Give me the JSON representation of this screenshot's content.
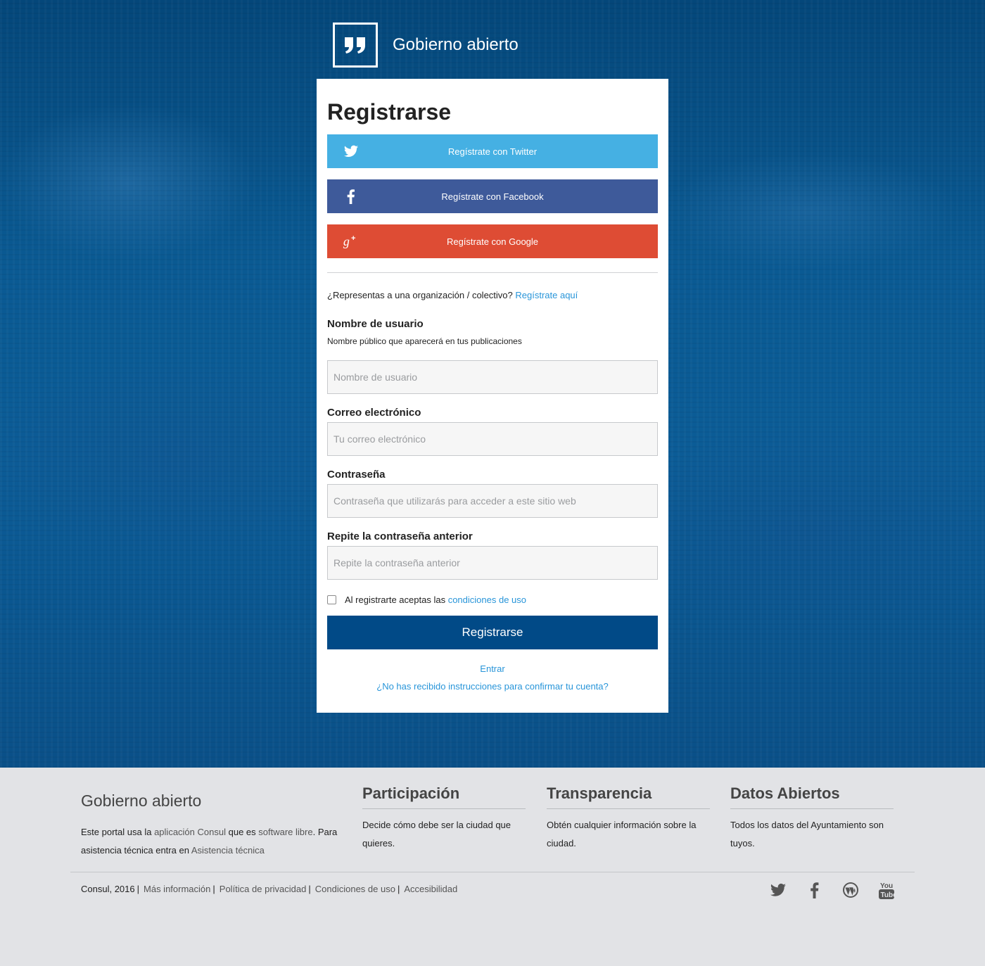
{
  "brand": {
    "name": "Gobierno abierto"
  },
  "form": {
    "title": "Registrarse",
    "twitter_label": "Regístrate con Twitter",
    "facebook_label": "Regístrate con Facebook",
    "google_label": "Regístrate con Google",
    "org_question": "¿Representas a una organización / colectivo?",
    "org_link": "Regístrate aquí",
    "username_label": "Nombre de usuario",
    "username_help": "Nombre público que aparecerá en tus publicaciones",
    "username_placeholder": "Nombre de usuario",
    "email_label": "Correo electrónico",
    "email_placeholder": "Tu correo electrónico",
    "password_label": "Contraseña",
    "password_placeholder": "Contraseña que utilizarás para acceder a este sitio web",
    "password_confirm_label": "Repite la contraseña anterior",
    "password_confirm_placeholder": "Repite la contraseña anterior",
    "terms_text": "Al registrarte aceptas las",
    "terms_link": "condiciones de uso",
    "terms_checked": false,
    "submit_label": "Registrarse",
    "login_link": "Entrar",
    "confirm_link": "¿No has recibido instrucciones para confirmar tu cuenta?"
  },
  "footer": {
    "brand": "Gobierno abierto",
    "desc_1": "Este portal usa la",
    "desc_link_1": "aplicación Consul",
    "desc_2": "que es",
    "desc_link_2": "software libre",
    "desc_3": ". Para asistencia técnica entra en",
    "desc_link_3": "Asistencia técnica",
    "columns": [
      {
        "title": "Participación",
        "text": "Decide cómo debe ser la ciudad que quieres."
      },
      {
        "title": "Transparencia",
        "text": "Obtén cualquier información sobre la ciudad."
      },
      {
        "title": "Datos Abiertos",
        "text": "Todos los datos del Ayuntamiento son tuyos."
      }
    ],
    "copyright": "Consul, 2016",
    "links": [
      "Más información",
      "Política de privacidad",
      "Condiciones de uso",
      "Accesibilidad"
    ],
    "social_icons": [
      "twitter-icon",
      "facebook-icon",
      "wordpress-icon",
      "youtube-icon"
    ]
  },
  "colors": {
    "hero": "#0a5a93",
    "twitter": "#45b0e3",
    "facebook": "#3e5a9a",
    "google": "#de4c34",
    "primary": "#014a87",
    "link": "#2895d9",
    "footer_bg": "#e2e3e6"
  }
}
